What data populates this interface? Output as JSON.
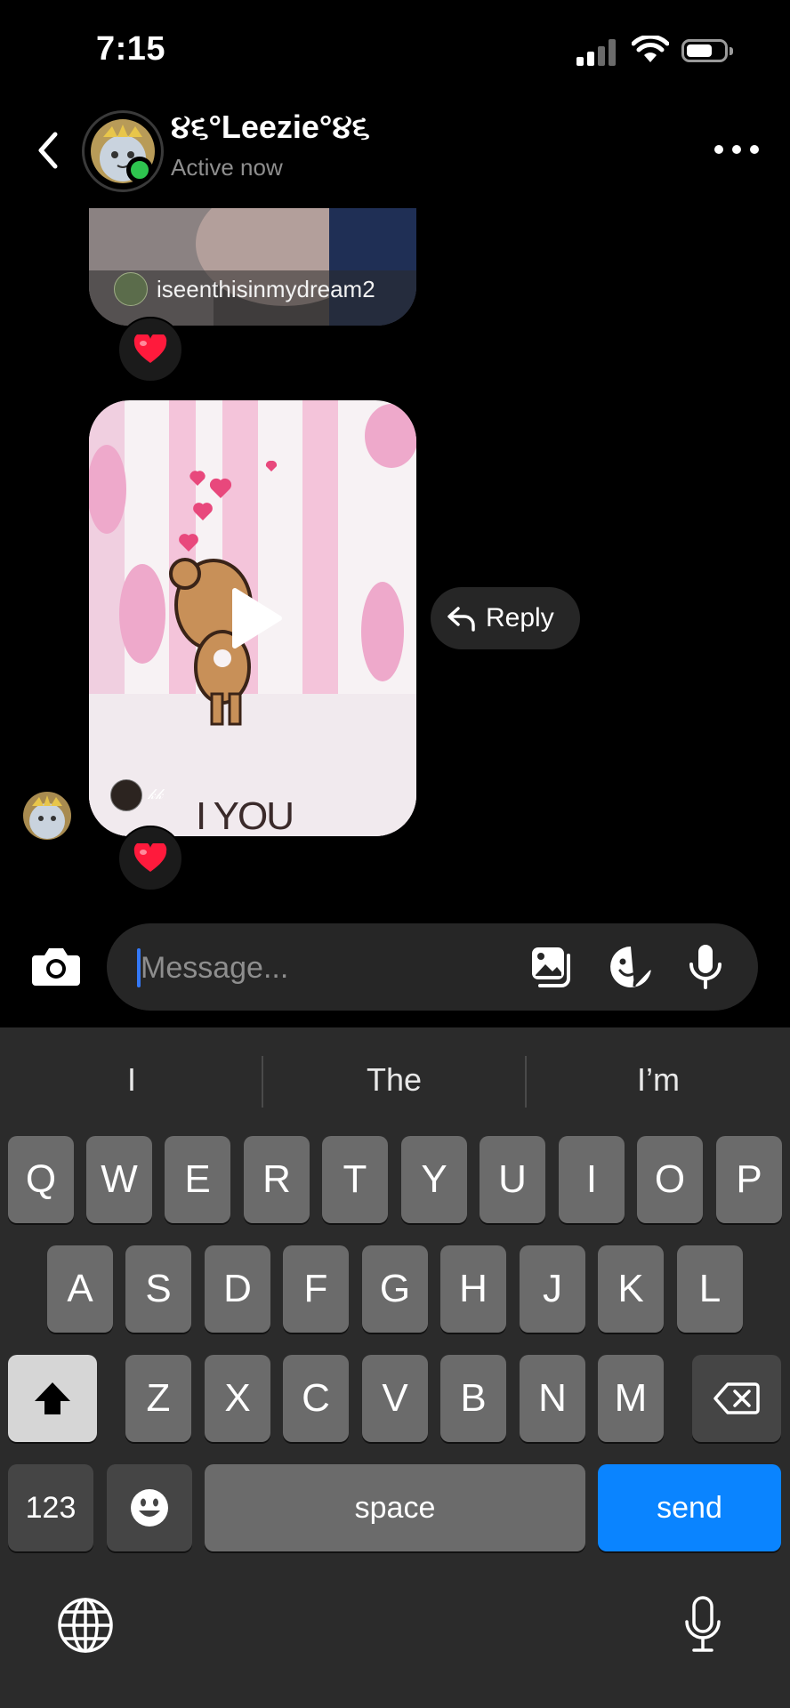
{
  "status": {
    "time": "7:15"
  },
  "header": {
    "contact_name": "૪૬°Leezie°૪૬",
    "status": "Active now"
  },
  "messages": [
    {
      "type": "shared_post",
      "username": "iseenthisinmydream2",
      "reaction": "red-heart"
    },
    {
      "type": "video",
      "username": "𝓀𝓀",
      "caption": "I YOU",
      "reaction": "red-heart"
    }
  ],
  "reply_label": "Reply",
  "composer": {
    "placeholder": "Message..."
  },
  "suggestions": [
    "I",
    "The",
    "I’m"
  ],
  "keyboard": {
    "row1": [
      "Q",
      "W",
      "E",
      "R",
      "T",
      "Y",
      "U",
      "I",
      "O",
      "P"
    ],
    "row2": [
      "A",
      "S",
      "D",
      "F",
      "G",
      "H",
      "J",
      "K",
      "L"
    ],
    "row3": [
      "Z",
      "X",
      "C",
      "V",
      "B",
      "N",
      "M"
    ],
    "numbers_label": "123",
    "space_label": "space",
    "send_label": "send"
  },
  "colors": {
    "background": "#000000",
    "online": "#2ec44f",
    "send_key": "#0a84ff",
    "keyboard_bg": "#2b2b2b"
  }
}
